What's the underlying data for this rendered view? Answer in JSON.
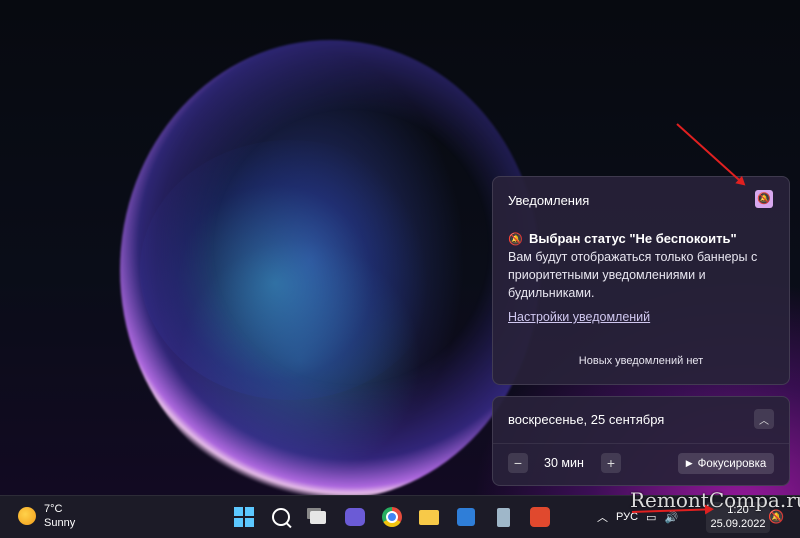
{
  "notifications": {
    "title": "Уведомления",
    "status_title": "Выбран статус \"Не беспокоить\"",
    "status_description": "Вам будут отображаться только баннеры с приоритетными уведомлениями и будильниками.",
    "settings_link": "Настройки уведомлений",
    "empty_message": "Новых уведомлений нет"
  },
  "calendar": {
    "date": "воскресенье, 25 сентября",
    "focus_duration": "30 мин",
    "focus_button": "Фокусировка"
  },
  "taskbar": {
    "weather": {
      "temperature": "7°C",
      "condition": "Sunny"
    },
    "language": "РУС",
    "time": "1:20",
    "date": "25.09.2022",
    "pinned_icons": [
      "windows-start-icon",
      "search-icon",
      "task-view-icon",
      "chat-icon",
      "chrome-icon",
      "file-explorer-icon",
      "store-icon",
      "recycle-bin-icon",
      "red-app-icon"
    ]
  },
  "watermark": "RemontCompa.ru",
  "colors": {
    "accent_toggle": "#d8a8ee",
    "annotation_arrow": "#e02020",
    "start_icon": "#5cc8ff"
  }
}
